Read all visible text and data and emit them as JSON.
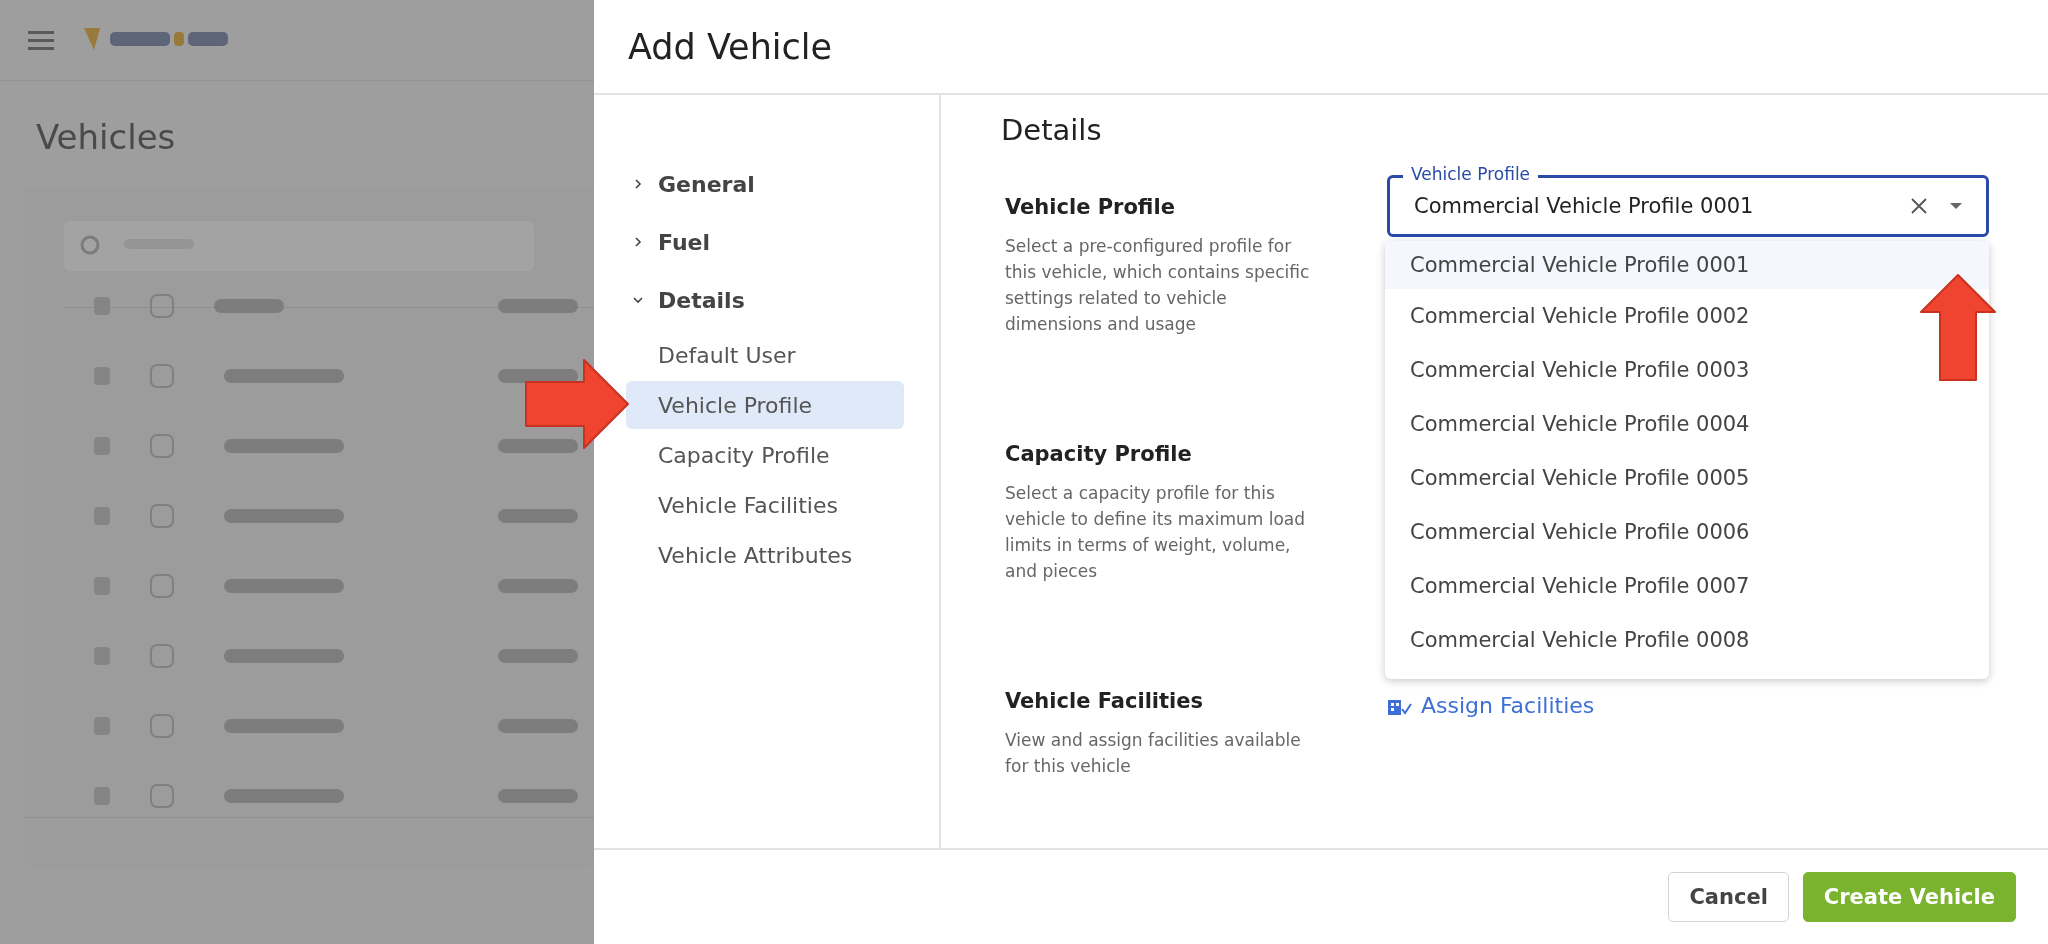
{
  "backdrop": {
    "page_title": "Vehicles"
  },
  "dialog": {
    "title": "Add Vehicle"
  },
  "nav": [
    {
      "label": "General",
      "expanded": false
    },
    {
      "label": "Fuel",
      "expanded": false
    },
    {
      "label": "Details",
      "expanded": true,
      "children": [
        {
          "label": "Default User",
          "selected": false
        },
        {
          "label": "Vehicle Profile",
          "selected": true
        },
        {
          "label": "Capacity Profile",
          "selected": false
        },
        {
          "label": "Vehicle Facilities",
          "selected": false
        },
        {
          "label": "Vehicle Attributes",
          "selected": false
        }
      ]
    }
  ],
  "content": {
    "heading": "Details",
    "sections": [
      {
        "kind": "select",
        "title": "Vehicle Profile",
        "description": "Select a pre-configured profile for this vehicle, which contains specific settings related to vehicle dimensions and usage"
      },
      {
        "kind": "covered",
        "title": "Capacity Profile",
        "description": "Select a capacity profile for this vehicle to define its maximum load limits in terms of weight, volume, and pieces"
      },
      {
        "kind": "link",
        "title": "Vehicle Facilities",
        "description": "View and assign facilities available for this vehicle",
        "link": "Assign Facilities"
      }
    ]
  },
  "vehicle_profile_field": {
    "label": "Vehicle Profile",
    "value": "Commercial Vehicle Profile 0001",
    "expanded": true,
    "options": [
      {
        "label": "Commercial Vehicle Profile 0001",
        "selected": true
      },
      {
        "label": "Commercial Vehicle Profile 0002",
        "selected": false
      },
      {
        "label": "Commercial Vehicle Profile 0003",
        "selected": false
      },
      {
        "label": "Commercial Vehicle Profile 0004",
        "selected": false
      },
      {
        "label": "Commercial Vehicle Profile 0005",
        "selected": false
      },
      {
        "label": "Commercial Vehicle Profile 0006",
        "selected": false
      },
      {
        "label": "Commercial Vehicle Profile 0007",
        "selected": false
      },
      {
        "label": "Commercial Vehicle Profile 0008",
        "selected": false
      }
    ]
  },
  "buttons": [
    {
      "label": "Cancel",
      "kind": "secondary"
    },
    {
      "label": "Create Vehicle",
      "kind": "primary"
    }
  ]
}
